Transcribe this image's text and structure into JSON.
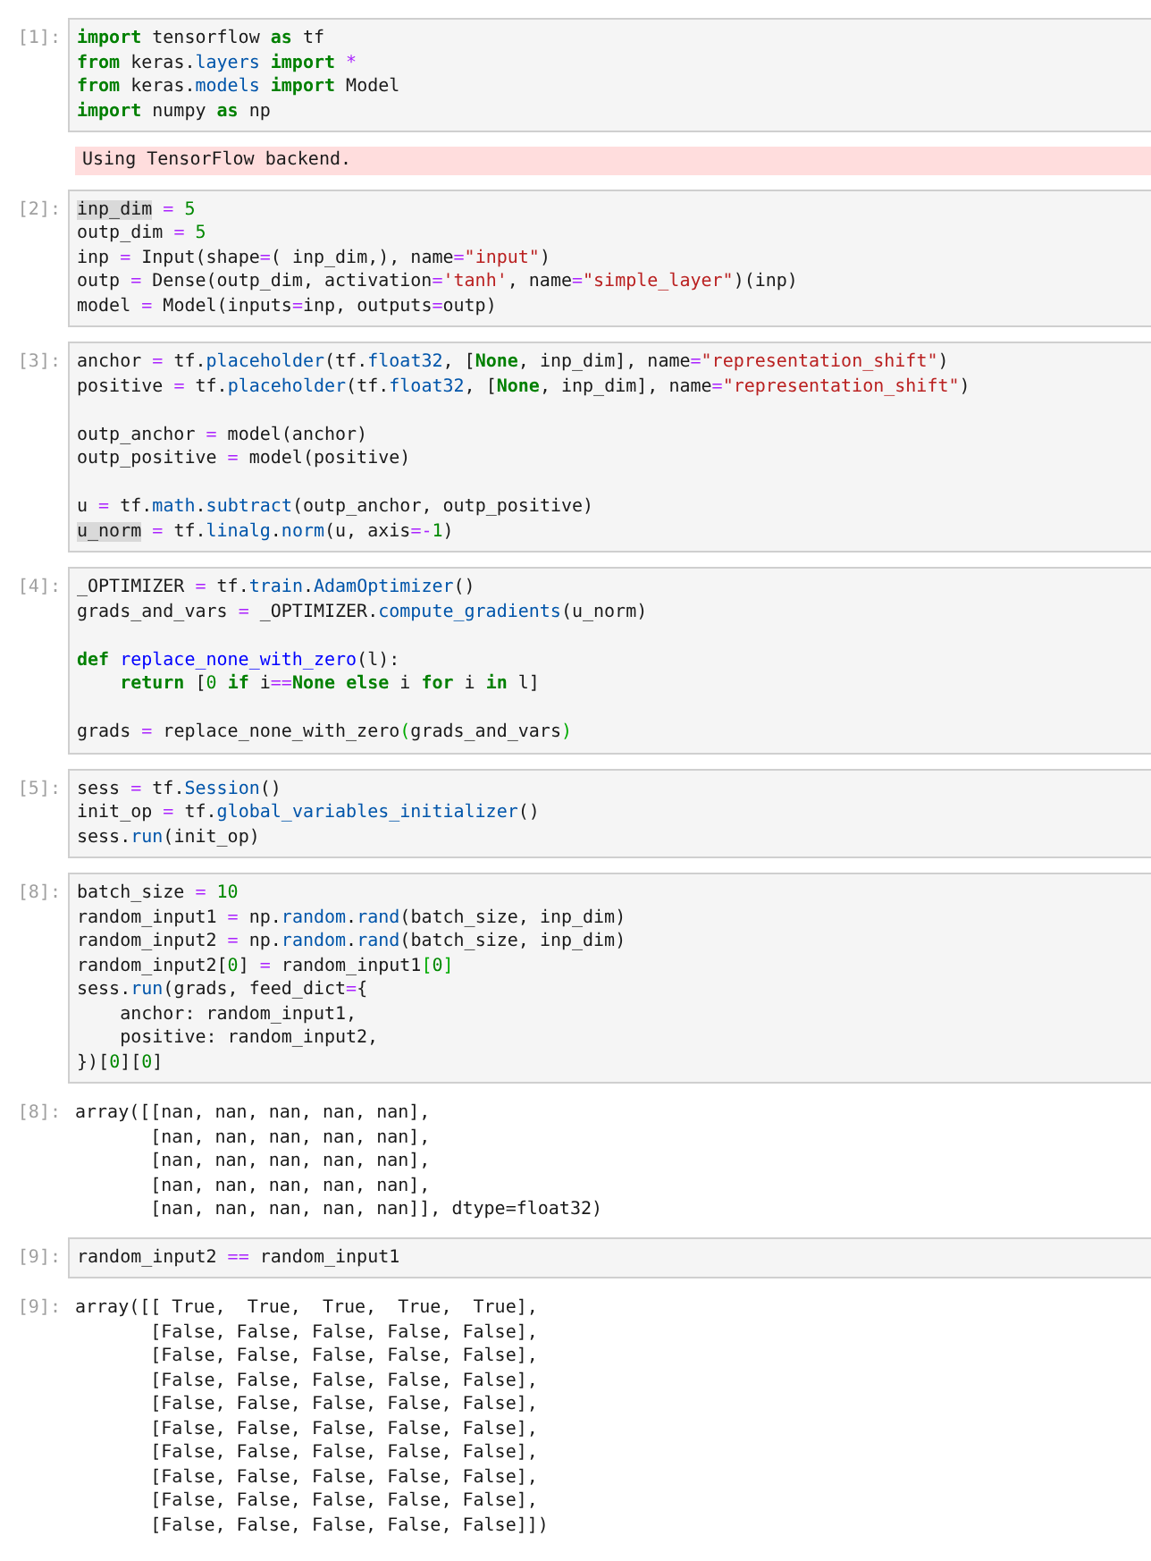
{
  "cells": [
    {
      "kind": "input",
      "prompt": "[1]:",
      "blocks": [
        [
          [
            {
              "kind": "keyword",
              "text": "import"
            },
            {
              "kind": "plain",
              "text": " tensorflow "
            },
            {
              "kind": "keyword",
              "text": "as"
            },
            {
              "kind": "plain",
              "text": " tf"
            }
          ],
          [
            {
              "kind": "keyword",
              "text": "from"
            },
            {
              "kind": "plain",
              "text": " keras."
            },
            {
              "kind": "attribute",
              "text": "layers"
            },
            {
              "kind": "keyword",
              "text": " import"
            },
            {
              "kind": "operator",
              "text": " *"
            }
          ],
          [
            {
              "kind": "keyword",
              "text": "from"
            },
            {
              "kind": "plain",
              "text": " keras."
            },
            {
              "kind": "attribute",
              "text": "models"
            },
            {
              "kind": "keyword",
              "text": " import"
            },
            {
              "kind": "plain",
              "text": " Model"
            }
          ],
          [
            {
              "kind": "keyword",
              "text": "import"
            },
            {
              "kind": "plain",
              "text": " numpy "
            },
            {
              "kind": "keyword",
              "text": "as"
            },
            {
              "kind": "plain",
              "text": " np"
            }
          ]
        ]
      ]
    },
    {
      "kind": "stderr",
      "lines": [
        "Using TensorFlow backend."
      ]
    },
    {
      "kind": "input",
      "prompt": "[2]:",
      "blocks": [
        [
          [
            {
              "kind": "selection",
              "text": "inp_dim"
            },
            {
              "kind": "operator",
              "text": " ="
            },
            {
              "kind": "number",
              "text": " 5"
            }
          ],
          [
            {
              "kind": "plain",
              "text": "outp_dim "
            },
            {
              "kind": "operator",
              "text": "="
            },
            {
              "kind": "number",
              "text": " 5"
            }
          ],
          [
            {
              "kind": "plain",
              "text": "inp "
            },
            {
              "kind": "operator",
              "text": "="
            },
            {
              "kind": "plain",
              "text": " Input(shape"
            },
            {
              "kind": "operator",
              "text": "="
            },
            {
              "kind": "plain",
              "text": "( inp_dim,), name"
            },
            {
              "kind": "operator",
              "text": "="
            },
            {
              "kind": "string",
              "text": "\"input\""
            },
            {
              "kind": "plain",
              "text": ")"
            }
          ],
          [
            {
              "kind": "plain",
              "text": "outp "
            },
            {
              "kind": "operator",
              "text": "="
            },
            {
              "kind": "plain",
              "text": " Dense(outp_dim, activation"
            },
            {
              "kind": "operator",
              "text": "="
            },
            {
              "kind": "string",
              "text": "'tanh'"
            },
            {
              "kind": "plain",
              "text": ", name"
            },
            {
              "kind": "operator",
              "text": "="
            },
            {
              "kind": "string",
              "text": "\"simple_layer\""
            },
            {
              "kind": "plain",
              "text": ")(inp)"
            }
          ],
          [
            {
              "kind": "plain",
              "text": "model "
            },
            {
              "kind": "operator",
              "text": "="
            },
            {
              "kind": "plain",
              "text": " Model(inputs"
            },
            {
              "kind": "operator",
              "text": "="
            },
            {
              "kind": "plain",
              "text": "inp, outputs"
            },
            {
              "kind": "operator",
              "text": "="
            },
            {
              "kind": "plain",
              "text": "outp)"
            }
          ]
        ]
      ]
    },
    {
      "kind": "input",
      "prompt": "[3]:",
      "blocks": [
        [
          [
            {
              "kind": "plain",
              "text": "anchor "
            },
            {
              "kind": "operator",
              "text": "="
            },
            {
              "kind": "plain",
              "text": " tf."
            },
            {
              "kind": "attribute",
              "text": "placeholder"
            },
            {
              "kind": "plain",
              "text": "(tf."
            },
            {
              "kind": "attribute",
              "text": "float32"
            },
            {
              "kind": "plain",
              "text": ", ["
            },
            {
              "kind": "keyword",
              "text": "None"
            },
            {
              "kind": "plain",
              "text": ", inp_dim], name"
            },
            {
              "kind": "operator",
              "text": "="
            },
            {
              "kind": "string",
              "text": "\"representation_shift\""
            },
            {
              "kind": "plain",
              "text": ")"
            }
          ],
          [
            {
              "kind": "plain",
              "text": "positive "
            },
            {
              "kind": "operator",
              "text": "="
            },
            {
              "kind": "plain",
              "text": " tf."
            },
            {
              "kind": "attribute",
              "text": "placeholder"
            },
            {
              "kind": "plain",
              "text": "(tf."
            },
            {
              "kind": "attribute",
              "text": "float32"
            },
            {
              "kind": "plain",
              "text": ", ["
            },
            {
              "kind": "keyword",
              "text": "None"
            },
            {
              "kind": "plain",
              "text": ", inp_dim], name"
            },
            {
              "kind": "operator",
              "text": "="
            },
            {
              "kind": "string",
              "text": "\"representation_shift\""
            },
            {
              "kind": "plain",
              "text": ")"
            }
          ]
        ],
        [
          [
            {
              "kind": "plain",
              "text": "outp_anchor "
            },
            {
              "kind": "operator",
              "text": "="
            },
            {
              "kind": "plain",
              "text": " model(anchor)"
            }
          ],
          [
            {
              "kind": "plain",
              "text": "outp_positive "
            },
            {
              "kind": "operator",
              "text": "="
            },
            {
              "kind": "plain",
              "text": " model(positive)"
            }
          ]
        ],
        [
          [
            {
              "kind": "plain",
              "text": "u "
            },
            {
              "kind": "operator",
              "text": "="
            },
            {
              "kind": "plain",
              "text": " tf."
            },
            {
              "kind": "attribute",
              "text": "math"
            },
            {
              "kind": "plain",
              "text": "."
            },
            {
              "kind": "attribute",
              "text": "subtract"
            },
            {
              "kind": "plain",
              "text": "(outp_anchor, outp_positive)"
            }
          ],
          [
            {
              "kind": "selection",
              "text": "u_norm"
            },
            {
              "kind": "operator",
              "text": " ="
            },
            {
              "kind": "plain",
              "text": " tf."
            },
            {
              "kind": "attribute",
              "text": "linalg"
            },
            {
              "kind": "plain",
              "text": "."
            },
            {
              "kind": "attribute",
              "text": "norm"
            },
            {
              "kind": "plain",
              "text": "(u, axis"
            },
            {
              "kind": "operator",
              "text": "=-"
            },
            {
              "kind": "number",
              "text": "1"
            },
            {
              "kind": "plain",
              "text": ")"
            }
          ]
        ]
      ]
    },
    {
      "kind": "input",
      "prompt": "[4]:",
      "blocks": [
        [
          [
            {
              "kind": "plain",
              "text": "_OPTIMIZER "
            },
            {
              "kind": "operator",
              "text": "="
            },
            {
              "kind": "plain",
              "text": " tf."
            },
            {
              "kind": "attribute",
              "text": "train"
            },
            {
              "kind": "plain",
              "text": "."
            },
            {
              "kind": "attribute",
              "text": "AdamOptimizer"
            },
            {
              "kind": "plain",
              "text": "()"
            }
          ],
          [
            {
              "kind": "plain",
              "text": "grads_and_vars "
            },
            {
              "kind": "operator",
              "text": "="
            },
            {
              "kind": "plain",
              "text": " _OPTIMIZER."
            },
            {
              "kind": "attribute",
              "text": "compute_gradients"
            },
            {
              "kind": "plain",
              "text": "(u_norm)"
            }
          ]
        ],
        [
          [
            {
              "kind": "keyword",
              "text": "def"
            },
            {
              "kind": "function",
              "text": " replace_none_with_zero"
            },
            {
              "kind": "plain",
              "text": "(l):"
            }
          ],
          [
            {
              "kind": "keyword",
              "text": "    return"
            },
            {
              "kind": "plain",
              "text": " ["
            },
            {
              "kind": "number",
              "text": "0"
            },
            {
              "kind": "keyword",
              "text": " if"
            },
            {
              "kind": "plain",
              "text": " i"
            },
            {
              "kind": "operator",
              "text": "=="
            },
            {
              "kind": "keyword",
              "text": "None"
            },
            {
              "kind": "keyword",
              "text": " else"
            },
            {
              "kind": "plain",
              "text": " i "
            },
            {
              "kind": "keyword",
              "text": "for"
            },
            {
              "kind": "plain",
              "text": " i "
            },
            {
              "kind": "keyword",
              "text": "in"
            },
            {
              "kind": "plain",
              "text": " l]"
            }
          ]
        ],
        [
          [
            {
              "kind": "plain",
              "text": "grads "
            },
            {
              "kind": "operator",
              "text": "="
            },
            {
              "kind": "plain",
              "text": " replace_none_with_zero"
            },
            {
              "kind": "bracket",
              "text": "("
            },
            {
              "kind": "plain",
              "text": "grads_and_vars"
            },
            {
              "kind": "bracket",
              "text": ")"
            }
          ]
        ]
      ]
    },
    {
      "kind": "input",
      "prompt": "[5]:",
      "blocks": [
        [
          [
            {
              "kind": "plain",
              "text": "sess "
            },
            {
              "kind": "operator",
              "text": "="
            },
            {
              "kind": "plain",
              "text": " tf."
            },
            {
              "kind": "attribute",
              "text": "Session"
            },
            {
              "kind": "plain",
              "text": "()"
            }
          ],
          [
            {
              "kind": "plain",
              "text": "init_op "
            },
            {
              "kind": "operator",
              "text": "="
            },
            {
              "kind": "plain",
              "text": " tf."
            },
            {
              "kind": "attribute",
              "text": "global_variables_initializer"
            },
            {
              "kind": "plain",
              "text": "()"
            }
          ],
          [
            {
              "kind": "plain",
              "text": "sess."
            },
            {
              "kind": "attribute",
              "text": "run"
            },
            {
              "kind": "plain",
              "text": "(init_op)"
            }
          ]
        ]
      ]
    },
    {
      "kind": "input",
      "prompt": "[8]:",
      "blocks": [
        [
          [
            {
              "kind": "plain",
              "text": "batch_size "
            },
            {
              "kind": "operator",
              "text": "="
            },
            {
              "kind": "number",
              "text": " 10"
            }
          ],
          [
            {
              "kind": "plain",
              "text": "random_input1 "
            },
            {
              "kind": "operator",
              "text": "="
            },
            {
              "kind": "plain",
              "text": " np."
            },
            {
              "kind": "attribute",
              "text": "random"
            },
            {
              "kind": "plain",
              "text": "."
            },
            {
              "kind": "attribute",
              "text": "rand"
            },
            {
              "kind": "plain",
              "text": "(batch_size, inp_dim)"
            }
          ],
          [
            {
              "kind": "plain",
              "text": "random_input2 "
            },
            {
              "kind": "operator",
              "text": "="
            },
            {
              "kind": "plain",
              "text": " np."
            },
            {
              "kind": "attribute",
              "text": "random"
            },
            {
              "kind": "plain",
              "text": "."
            },
            {
              "kind": "attribute",
              "text": "rand"
            },
            {
              "kind": "plain",
              "text": "(batch_size, inp_dim)"
            }
          ],
          [
            {
              "kind": "plain",
              "text": "random_input2["
            },
            {
              "kind": "number",
              "text": "0"
            },
            {
              "kind": "plain",
              "text": "] "
            },
            {
              "kind": "operator",
              "text": "="
            },
            {
              "kind": "plain",
              "text": " random_input1"
            },
            {
              "kind": "bracket",
              "text": "["
            },
            {
              "kind": "number",
              "text": "0"
            },
            {
              "kind": "bracket",
              "text": "]"
            }
          ],
          [
            {
              "kind": "plain",
              "text": "sess."
            },
            {
              "kind": "attribute",
              "text": "run"
            },
            {
              "kind": "plain",
              "text": "(grads, feed_dict"
            },
            {
              "kind": "operator",
              "text": "="
            },
            {
              "kind": "plain",
              "text": "{"
            }
          ],
          [
            {
              "kind": "plain",
              "text": "    anchor: random_input1,"
            }
          ],
          [
            {
              "kind": "plain",
              "text": "    positive: random_input2,"
            }
          ],
          [
            {
              "kind": "plain",
              "text": "})["
            },
            {
              "kind": "number",
              "text": "0"
            },
            {
              "kind": "plain",
              "text": "]["
            },
            {
              "kind": "number",
              "text": "0"
            },
            {
              "kind": "plain",
              "text": "]"
            }
          ]
        ]
      ]
    },
    {
      "kind": "output",
      "prompt": "[8]:",
      "lines": [
        "array([[nan, nan, nan, nan, nan],",
        "       [nan, nan, nan, nan, nan],",
        "       [nan, nan, nan, nan, nan],",
        "       [nan, nan, nan, nan, nan],",
        "       [nan, nan, nan, nan, nan]], dtype=float32)"
      ]
    },
    {
      "kind": "input",
      "prompt": "[9]:",
      "blocks": [
        [
          [
            {
              "kind": "plain",
              "text": "random_input2 "
            },
            {
              "kind": "operator",
              "text": "=="
            },
            {
              "kind": "plain",
              "text": " random_input1"
            }
          ]
        ]
      ]
    },
    {
      "kind": "output",
      "prompt": "[9]:",
      "lines": [
        "array([[ True,  True,  True,  True,  True],",
        "       [False, False, False, False, False],",
        "       [False, False, False, False, False],",
        "       [False, False, False, False, False],",
        "       [False, False, False, False, False],",
        "       [False, False, False, False, False],",
        "       [False, False, False, False, False],",
        "       [False, False, False, False, False],",
        "       [False, False, False, False, False],",
        "       [False, False, False, False, False]])"
      ]
    }
  ]
}
